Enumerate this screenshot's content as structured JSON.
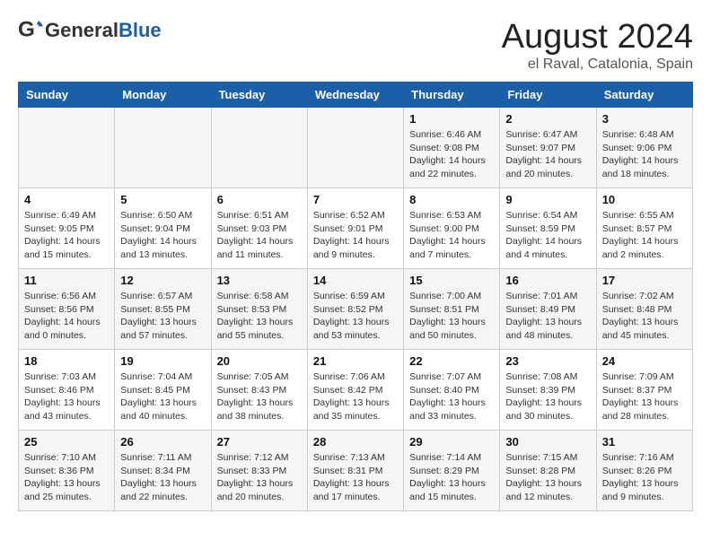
{
  "header": {
    "logo_general": "General",
    "logo_blue": "Blue",
    "month_year": "August 2024",
    "location": "el Raval, Catalonia, Spain"
  },
  "days_of_week": [
    "Sunday",
    "Monday",
    "Tuesday",
    "Wednesday",
    "Thursday",
    "Friday",
    "Saturday"
  ],
  "weeks": [
    [
      {
        "day": "",
        "info": ""
      },
      {
        "day": "",
        "info": ""
      },
      {
        "day": "",
        "info": ""
      },
      {
        "day": "",
        "info": ""
      },
      {
        "day": "1",
        "info": "Sunrise: 6:46 AM\nSunset: 9:08 PM\nDaylight: 14 hours\nand 22 minutes."
      },
      {
        "day": "2",
        "info": "Sunrise: 6:47 AM\nSunset: 9:07 PM\nDaylight: 14 hours\nand 20 minutes."
      },
      {
        "day": "3",
        "info": "Sunrise: 6:48 AM\nSunset: 9:06 PM\nDaylight: 14 hours\nand 18 minutes."
      }
    ],
    [
      {
        "day": "4",
        "info": "Sunrise: 6:49 AM\nSunset: 9:05 PM\nDaylight: 14 hours\nand 15 minutes."
      },
      {
        "day": "5",
        "info": "Sunrise: 6:50 AM\nSunset: 9:04 PM\nDaylight: 14 hours\nand 13 minutes."
      },
      {
        "day": "6",
        "info": "Sunrise: 6:51 AM\nSunset: 9:03 PM\nDaylight: 14 hours\nand 11 minutes."
      },
      {
        "day": "7",
        "info": "Sunrise: 6:52 AM\nSunset: 9:01 PM\nDaylight: 14 hours\nand 9 minutes."
      },
      {
        "day": "8",
        "info": "Sunrise: 6:53 AM\nSunset: 9:00 PM\nDaylight: 14 hours\nand 7 minutes."
      },
      {
        "day": "9",
        "info": "Sunrise: 6:54 AM\nSunset: 8:59 PM\nDaylight: 14 hours\nand 4 minutes."
      },
      {
        "day": "10",
        "info": "Sunrise: 6:55 AM\nSunset: 8:57 PM\nDaylight: 14 hours\nand 2 minutes."
      }
    ],
    [
      {
        "day": "11",
        "info": "Sunrise: 6:56 AM\nSunset: 8:56 PM\nDaylight: 14 hours\nand 0 minutes."
      },
      {
        "day": "12",
        "info": "Sunrise: 6:57 AM\nSunset: 8:55 PM\nDaylight: 13 hours\nand 57 minutes."
      },
      {
        "day": "13",
        "info": "Sunrise: 6:58 AM\nSunset: 8:53 PM\nDaylight: 13 hours\nand 55 minutes."
      },
      {
        "day": "14",
        "info": "Sunrise: 6:59 AM\nSunset: 8:52 PM\nDaylight: 13 hours\nand 53 minutes."
      },
      {
        "day": "15",
        "info": "Sunrise: 7:00 AM\nSunset: 8:51 PM\nDaylight: 13 hours\nand 50 minutes."
      },
      {
        "day": "16",
        "info": "Sunrise: 7:01 AM\nSunset: 8:49 PM\nDaylight: 13 hours\nand 48 minutes."
      },
      {
        "day": "17",
        "info": "Sunrise: 7:02 AM\nSunset: 8:48 PM\nDaylight: 13 hours\nand 45 minutes."
      }
    ],
    [
      {
        "day": "18",
        "info": "Sunrise: 7:03 AM\nSunset: 8:46 PM\nDaylight: 13 hours\nand 43 minutes."
      },
      {
        "day": "19",
        "info": "Sunrise: 7:04 AM\nSunset: 8:45 PM\nDaylight: 13 hours\nand 40 minutes."
      },
      {
        "day": "20",
        "info": "Sunrise: 7:05 AM\nSunset: 8:43 PM\nDaylight: 13 hours\nand 38 minutes."
      },
      {
        "day": "21",
        "info": "Sunrise: 7:06 AM\nSunset: 8:42 PM\nDaylight: 13 hours\nand 35 minutes."
      },
      {
        "day": "22",
        "info": "Sunrise: 7:07 AM\nSunset: 8:40 PM\nDaylight: 13 hours\nand 33 minutes."
      },
      {
        "day": "23",
        "info": "Sunrise: 7:08 AM\nSunset: 8:39 PM\nDaylight: 13 hours\nand 30 minutes."
      },
      {
        "day": "24",
        "info": "Sunrise: 7:09 AM\nSunset: 8:37 PM\nDaylight: 13 hours\nand 28 minutes."
      }
    ],
    [
      {
        "day": "25",
        "info": "Sunrise: 7:10 AM\nSunset: 8:36 PM\nDaylight: 13 hours\nand 25 minutes."
      },
      {
        "day": "26",
        "info": "Sunrise: 7:11 AM\nSunset: 8:34 PM\nDaylight: 13 hours\nand 22 minutes."
      },
      {
        "day": "27",
        "info": "Sunrise: 7:12 AM\nSunset: 8:33 PM\nDaylight: 13 hours\nand 20 minutes."
      },
      {
        "day": "28",
        "info": "Sunrise: 7:13 AM\nSunset: 8:31 PM\nDaylight: 13 hours\nand 17 minutes."
      },
      {
        "day": "29",
        "info": "Sunrise: 7:14 AM\nSunset: 8:29 PM\nDaylight: 13 hours\nand 15 minutes."
      },
      {
        "day": "30",
        "info": "Sunrise: 7:15 AM\nSunset: 8:28 PM\nDaylight: 13 hours\nand 12 minutes."
      },
      {
        "day": "31",
        "info": "Sunrise: 7:16 AM\nSunset: 8:26 PM\nDaylight: 13 hours\nand 9 minutes."
      }
    ]
  ]
}
